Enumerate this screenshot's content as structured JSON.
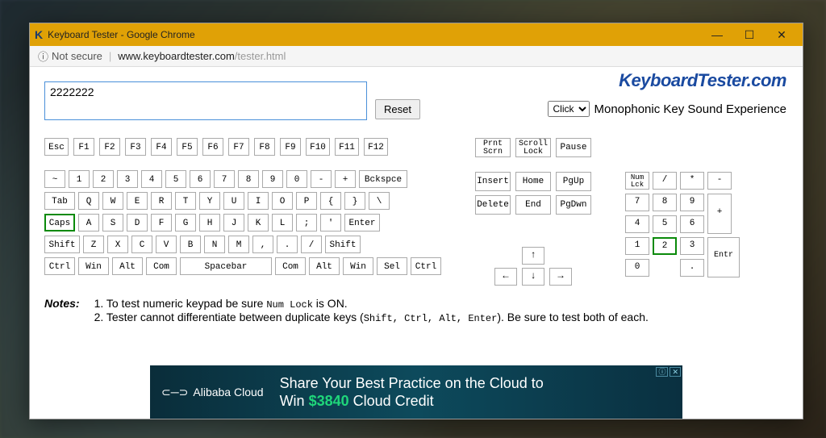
{
  "window": {
    "app_icon_letter": "K",
    "title": "Keyboard Tester - Google Chrome",
    "minimize": "—",
    "maximize": "☐",
    "close": "✕"
  },
  "addressbar": {
    "not_secure_icon": "ⓘ",
    "not_secure": "Not secure",
    "url_dark": "www.keyboardtester.com",
    "url_light": "/tester.html"
  },
  "brand": "KeyboardTester.com",
  "input_value": "2222222",
  "reset_label": "Reset",
  "sound": {
    "select_value": "Click",
    "text": "Monophonic Key Sound Experience"
  },
  "fkeys": [
    "Esc",
    "F1",
    "F2",
    "F3",
    "F4",
    "F5",
    "F6",
    "F7",
    "F8",
    "F9",
    "F10",
    "F11",
    "F12"
  ],
  "row1": [
    "~",
    "1",
    "2",
    "3",
    "4",
    "5",
    "6",
    "7",
    "8",
    "9",
    "0",
    "-",
    "+",
    "Bckspce"
  ],
  "row2": [
    "Tab",
    "Q",
    "W",
    "E",
    "R",
    "T",
    "Y",
    "U",
    "I",
    "O",
    "P",
    "{",
    "}",
    "\\"
  ],
  "row3": [
    "Caps",
    "A",
    "S",
    "D",
    "F",
    "G",
    "H",
    "J",
    "K",
    "L",
    ";",
    "'",
    "Enter"
  ],
  "row4": [
    "Shift",
    "Z",
    "X",
    "C",
    "V",
    "B",
    "N",
    "M",
    ",",
    ".",
    "/",
    "Shift"
  ],
  "row5": [
    "Ctrl",
    "Win",
    "Alt",
    "Com",
    "Spacebar",
    "Com",
    "Alt",
    "Win",
    "Sel",
    "Ctrl"
  ],
  "nav_top": [
    {
      "l1": "Prnt",
      "l2": "Scrn"
    },
    {
      "l1": "Scroll",
      "l2": "Lock"
    },
    {
      "l1": "Pause",
      "l2": ""
    }
  ],
  "nav_mid1": [
    "Insert",
    "Home",
    "PgUp"
  ],
  "nav_mid2": [
    "Delete",
    "End",
    "PgDwn"
  ],
  "arrows": {
    "up": "↑",
    "left": "←",
    "down": "↓",
    "right": "→"
  },
  "numpad": {
    "r0": [
      {
        "l1": "Num",
        "l2": "Lck"
      },
      "/",
      "*",
      "-"
    ],
    "r1": [
      "7",
      "8",
      "9"
    ],
    "r1_side": "+",
    "r2": [
      "4",
      "5",
      "6"
    ],
    "r3": [
      "1",
      "2",
      "3"
    ],
    "r3_side": "Entr",
    "r4": [
      "0",
      "",
      "."
    ]
  },
  "notes": {
    "label": "Notes:",
    "line1_a": "1. To test numeric keypad be sure ",
    "line1_code": "Num Lock",
    "line1_b": " is ON.",
    "line2_a": "2. Tester cannot differentiate between duplicate keys (",
    "line2_code": "Shift, Ctrl, Alt, Enter",
    "line2_b": "). Be sure to test both of each."
  },
  "ad": {
    "logo_text": "Alibaba Cloud",
    "line1": "Share Your Best Practice on the Cloud to",
    "line2_a": "Win ",
    "line2_highlight": "$3840",
    "line2_b": " Cloud Credit",
    "info": "ⓘ",
    "close": "✕"
  },
  "active_keys": {
    "caps": true,
    "numpad_2": true
  }
}
